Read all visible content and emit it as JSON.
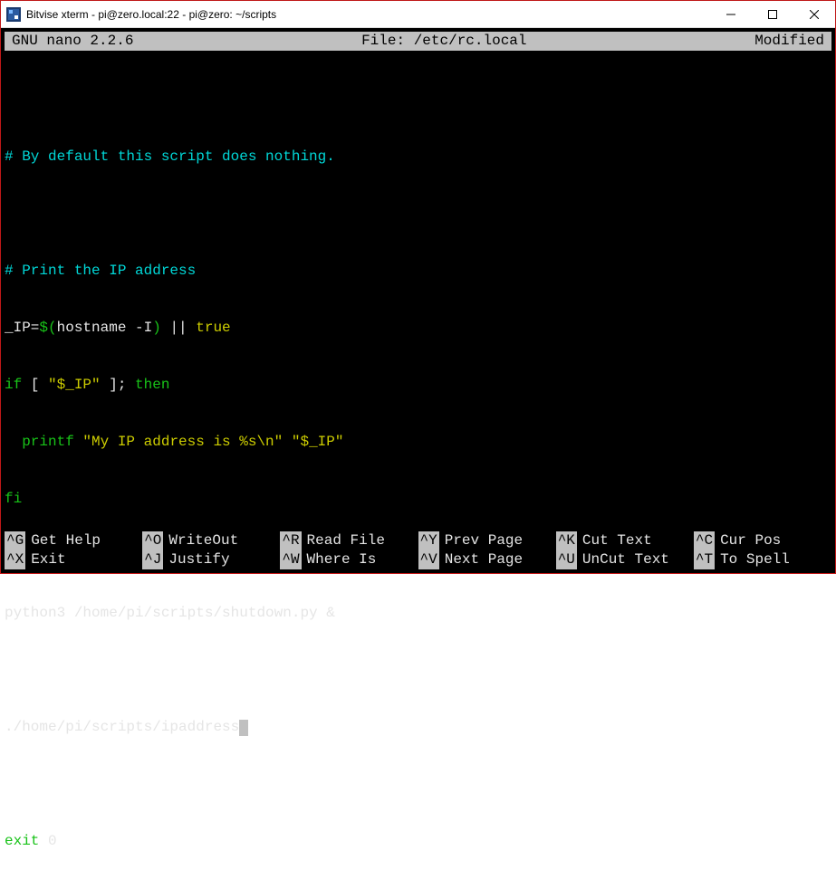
{
  "window": {
    "title": "Bitvise xterm - pi@zero.local:22 - pi@zero: ~/scripts"
  },
  "nano": {
    "version": "GNU nano 2.2.6",
    "file_label": "File: /etc/rc.local",
    "status": "Modified"
  },
  "content": {
    "l1": "",
    "l2": "# By default this script does nothing.",
    "l3": "",
    "l4": "# Print the IP address",
    "l5a": "_IP=",
    "l5b": "$(",
    "l5c": "hostname -I",
    "l5d": ")",
    "l5e": " || ",
    "l5f": "true",
    "l6a": "if",
    "l6b": " [ ",
    "l6c": "\"$_IP\"",
    "l6d": " ]; ",
    "l6e": "then",
    "l7a": "  ",
    "l7b": "printf",
    "l7c": " ",
    "l7d": "\"My IP address is %s\\n\"",
    "l7e": " ",
    "l7f": "\"$_IP\"",
    "l8": "fi",
    "l9": "",
    "l10": "python3 /home/pi/scripts/shutdown.py &",
    "l11": "",
    "l12": "./home/pi/scripts/ipaddress",
    "l13": "",
    "l14a": "exit",
    "l14b": " 0"
  },
  "shortcuts": {
    "row1": [
      {
        "key": "^G",
        "label": "Get Help"
      },
      {
        "key": "^O",
        "label": "WriteOut"
      },
      {
        "key": "^R",
        "label": "Read File"
      },
      {
        "key": "^Y",
        "label": "Prev Page"
      },
      {
        "key": "^K",
        "label": "Cut Text"
      },
      {
        "key": "^C",
        "label": "Cur Pos"
      }
    ],
    "row2": [
      {
        "key": "^X",
        "label": "Exit"
      },
      {
        "key": "^J",
        "label": "Justify"
      },
      {
        "key": "^W",
        "label": "Where Is"
      },
      {
        "key": "^V",
        "label": "Next Page"
      },
      {
        "key": "^U",
        "label": "UnCut Text"
      },
      {
        "key": "^T",
        "label": "To Spell"
      }
    ]
  }
}
